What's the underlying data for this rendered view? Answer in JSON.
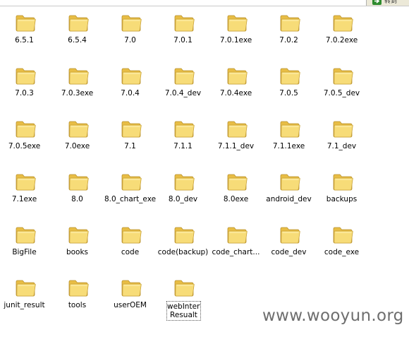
{
  "toolbar": {
    "go_label": "转到"
  },
  "folders": [
    "6.5.1",
    "6.5.4",
    "7.0",
    "7.0.1",
    "7.0.1exe",
    "7.0.2",
    "7.0.2exe",
    "7.0.3",
    "7.0.3exe",
    "7.0.4",
    "7.0.4_dev",
    "7.0.4exe",
    "7.0.5",
    "7.0.5_dev",
    "7.0.5exe",
    "7.0exe",
    "7.1",
    "7.1.1",
    "7.1.1_dev",
    "7.1.1exe",
    "7.1_dev",
    "7.1exe",
    "8.0",
    "8.0_chart_exe",
    "8.0_dev",
    "8.0exe",
    "android_dev",
    "backups",
    "BigFile",
    "books",
    "code",
    "code(backup)",
    "code_chart...",
    "code_dev",
    "code_exe",
    "junit_result",
    "tools",
    "userOEM",
    "webInterface\nResualt"
  ],
  "selected_folder": "webInterface\nResualt",
  "watermark": "www.wooyun.org",
  "colors": {
    "folder_fill": "#f6d66b",
    "folder_edge": "#c9a23a",
    "go_green": "#2e8b2e"
  }
}
